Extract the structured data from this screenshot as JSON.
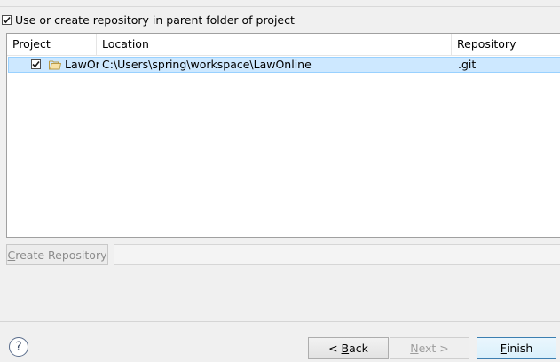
{
  "header": {
    "use_parent_repo_checked": true,
    "use_parent_repo_label": "Use or create repository in parent folder of project"
  },
  "table": {
    "columns": [
      "Project",
      "Location",
      "Repository"
    ],
    "rows": [
      {
        "checked": true,
        "project": "LawOr",
        "location": "C:\\Users\\spring\\workspace\\LawOnline",
        "repository": ".git"
      }
    ]
  },
  "actions": {
    "create_repository_label": "Create Repository",
    "create_repository_mnemonic": "C",
    "create_repository_rest": "reate Repository"
  },
  "footer": {
    "help_icon_glyph": "?",
    "back": {
      "mnemonic": "B",
      "prefix": "< ",
      "rest": "ack"
    },
    "next": {
      "label": "Next >",
      "mnemonic": "N",
      "rest": "ext >"
    },
    "finish": {
      "mnemonic": "F",
      "rest": "inish"
    }
  },
  "colors": {
    "selection_bg": "#cde8ff",
    "selection_border": "#99d1ff",
    "default_button_border": "#3c7fb1"
  }
}
